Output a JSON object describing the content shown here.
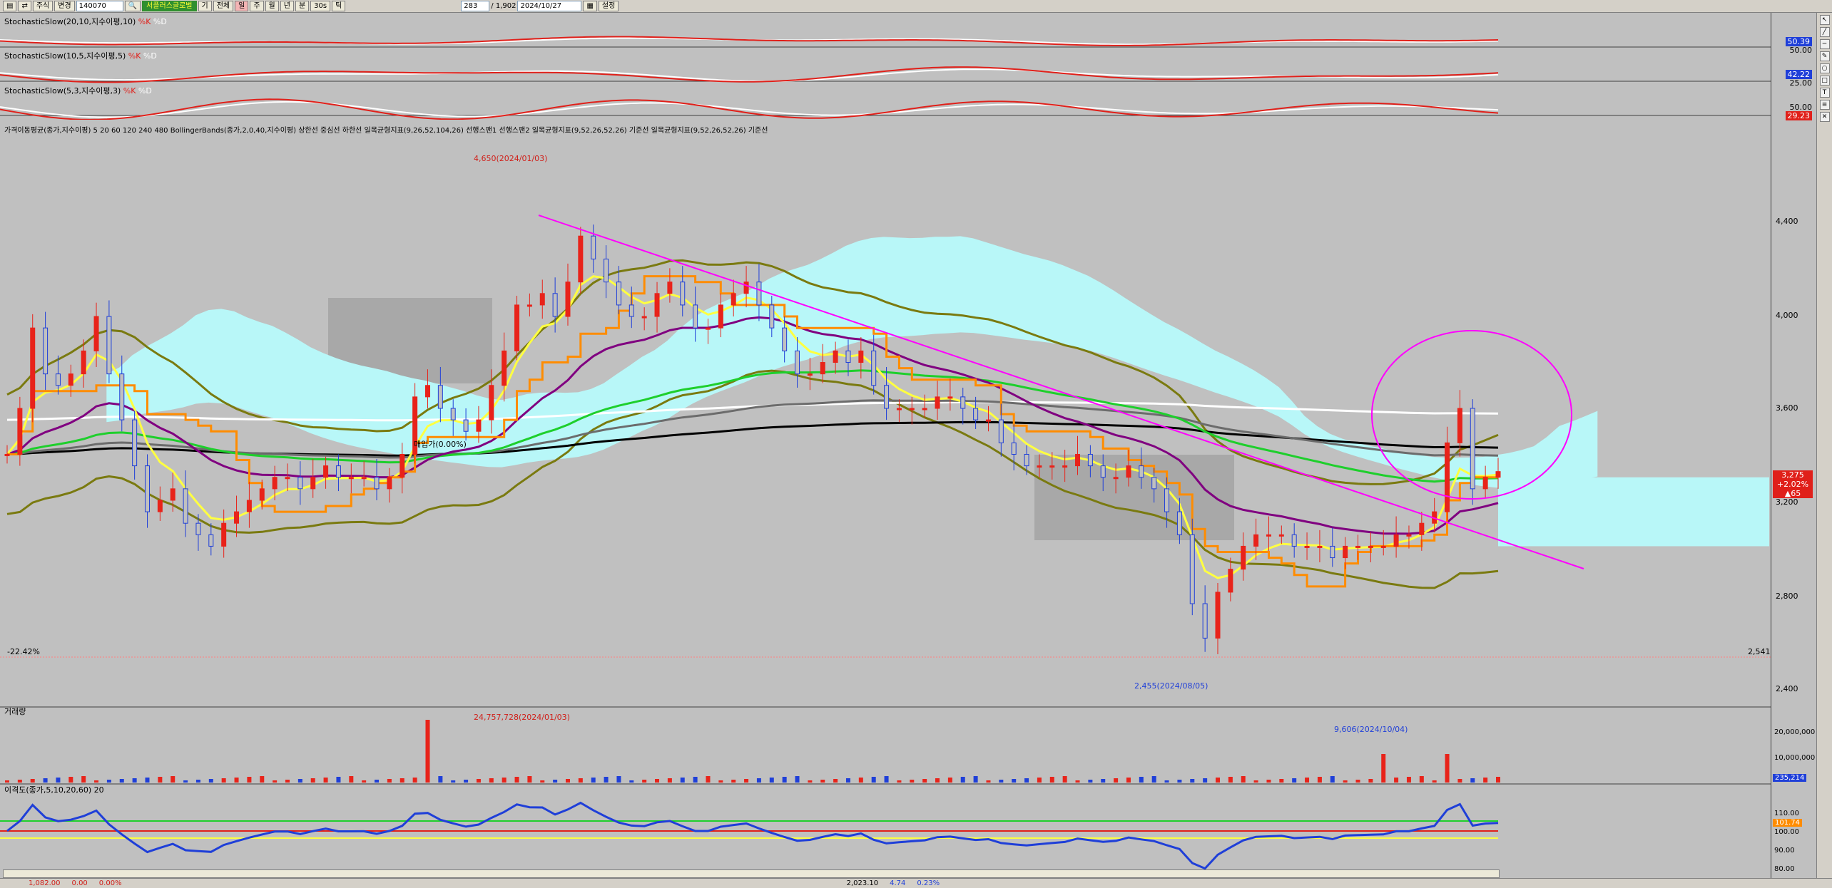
{
  "toolbar": {
    "market": "주식",
    "mode": "변경",
    "code": "140070",
    "stock_name": "서플러스글로벌",
    "btn_ki": "기",
    "btn_all": "전체",
    "btn_day": "일",
    "btn_week": "주",
    "btn_month": "월",
    "btn_year": "년",
    "btn_min": "분",
    "btn_30": "30s",
    "btn_tick": "틱",
    "count": "283",
    "total": "/ 1,902",
    "date": "2024/10/27",
    "settings": "설정"
  },
  "panels": {
    "stoch1_label": "StochasticSlow(20,10,지수이평,10)",
    "stoch2_label": "StochasticSlow(10,5,지수이평,5)",
    "stoch3_label": "StochasticSlow(5,3,지수이평,3)",
    "k_label": "%K",
    "d_label": "%D",
    "stoch1_k": "50.39",
    "stoch1_d": "50.00",
    "stoch2_k": "42.22",
    "stoch2_d": "25.00",
    "stoch3_k": "50.00",
    "stoch3_d": "29.23",
    "main_legend": "가격이동평균(종가,지수이평) 5 20 60 120 240 480  BollingerBands(종가,2,0,40,지수이평) 상한선 중심선 하한선  일목균형지표(9,26,52,104,26) 선행스팬1 선행스팬2  일목균형지표(9,52,26,52,26) 기준선  일목균형지표(9,52,26,52,26) 기준선",
    "volume_label": "거래량",
    "disparity_label": "이격도(종가,5,10,20,60) 20"
  },
  "annotations": {
    "high_label": "4,650(2024/01/03)",
    "low_label": "2,455(2024/08/05)",
    "mid_label": "매입가(0.00%)",
    "left_pct": "-22.42%",
    "right_val": "2,541",
    "vol_high_label": "24,757,728(2024/01/03)",
    "vol_recent_label": "9,606(2024/10/04)"
  },
  "price_axis": {
    "ticks": [
      "4,400",
      "4,000",
      "3,600",
      "3,200",
      "2,800",
      "2,400"
    ],
    "current_price": "3,275",
    "change_pct": "+2.02%",
    "change_abs": "▲65"
  },
  "volume_axis": {
    "ticks": [
      "20,000,000",
      "10,000,000"
    ],
    "current": "235,214"
  },
  "disparity_axis": {
    "ticks": [
      "110.00",
      "100.00",
      "90.00",
      "80.00"
    ],
    "current": "101.74"
  },
  "status": {
    "s1": "1,082.00",
    "s2": "0.00",
    "s3": "0.00%",
    "s4": "2,023.10",
    "s5": "4.74",
    "s6": "0.23%"
  },
  "chart_data": {
    "type": "candlestick",
    "title": "",
    "ylim": [
      2300,
      4800
    ],
    "colors": {
      "up": "#e8231a",
      "down": "#1f3fd8",
      "ma5": "#ffff40",
      "ma20": "#800080",
      "ma60": "#1ecf2c",
      "ma120": "#6c6c6c",
      "ma240": "#000000",
      "ma480": "#ffffff",
      "bb": "#7a7a10",
      "cloud": "#b8f7f8",
      "kijun": "#ff8c00",
      "trend": "#ff00ff"
    },
    "close": [
      3350,
      3550,
      3900,
      3700,
      3650,
      3700,
      3800,
      3950,
      3700,
      3500,
      3300,
      3100,
      3150,
      3200,
      3050,
      3000,
      2950,
      3050,
      3100,
      3150,
      3200,
      3250,
      3250,
      3200,
      3250,
      3300,
      3250,
      3250,
      3250,
      3200,
      3250,
      3350,
      3600,
      3650,
      3550,
      3500,
      3450,
      3500,
      3650,
      3800,
      4000,
      4000,
      4050,
      3950,
      4100,
      4300,
      4200,
      4100,
      4000,
      3950,
      3950,
      4050,
      4100,
      4000,
      3900,
      3900,
      4000,
      4050,
      4100,
      4000,
      3900,
      3800,
      3700,
      3700,
      3750,
      3800,
      3750,
      3800,
      3650,
      3550,
      3550,
      3550,
      3550,
      3600,
      3600,
      3550,
      3500,
      3500,
      3400,
      3350,
      3300,
      3300,
      3300,
      3300,
      3350,
      3300,
      3250,
      3250,
      3300,
      3250,
      3200,
      3100,
      3000,
      2700,
      2550,
      2750,
      2850,
      2950,
      3000,
      3000,
      3000,
      2950,
      2950,
      2950,
      2900,
      2950,
      2950,
      2950,
      2950,
      3000,
      3000,
      3050,
      3100,
      3400,
      3550,
      3200,
      3250,
      3275
    ]
  }
}
